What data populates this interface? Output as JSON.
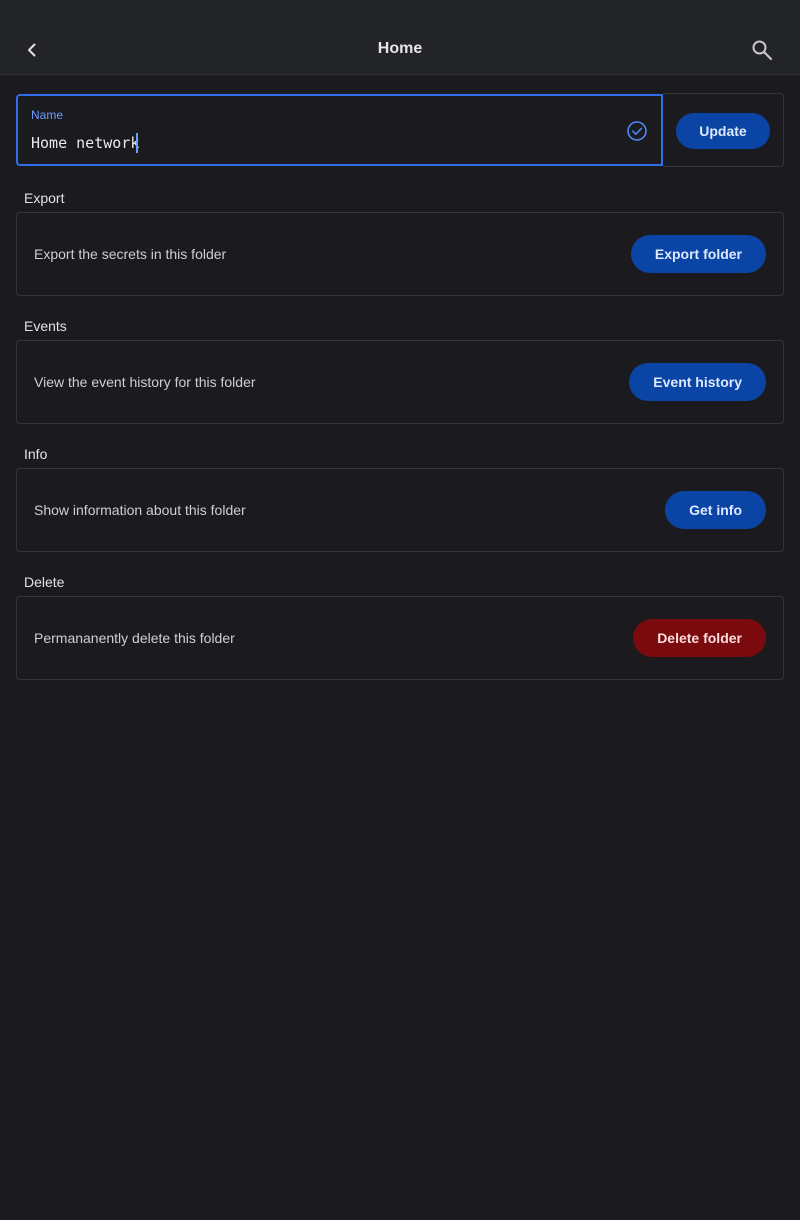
{
  "appbar": {
    "title": "Home",
    "back_icon": "chevron-left-icon",
    "search_icon": "search-icon"
  },
  "name_field": {
    "label": "Name",
    "value": "Home network",
    "status_icon": "check-circle-icon",
    "accent_color": "#2f6ee8"
  },
  "update_button": {
    "label": "Update"
  },
  "sections": {
    "export": {
      "title": "Export",
      "description": "Export the secrets in this folder",
      "button": "Export folder"
    },
    "events": {
      "title": "Events",
      "description": "View the event history for this folder",
      "button": "Event history"
    },
    "info": {
      "title": "Info",
      "description": "Show information about this folder",
      "button": "Get info"
    },
    "delete": {
      "title": "Delete",
      "description": "Permananently delete this folder",
      "button": "Delete folder"
    }
  },
  "colors": {
    "background": "#1b1b1f",
    "appbar": "#232428",
    "primary_button": "#0a45a6",
    "danger_button": "#7a0a0e"
  }
}
